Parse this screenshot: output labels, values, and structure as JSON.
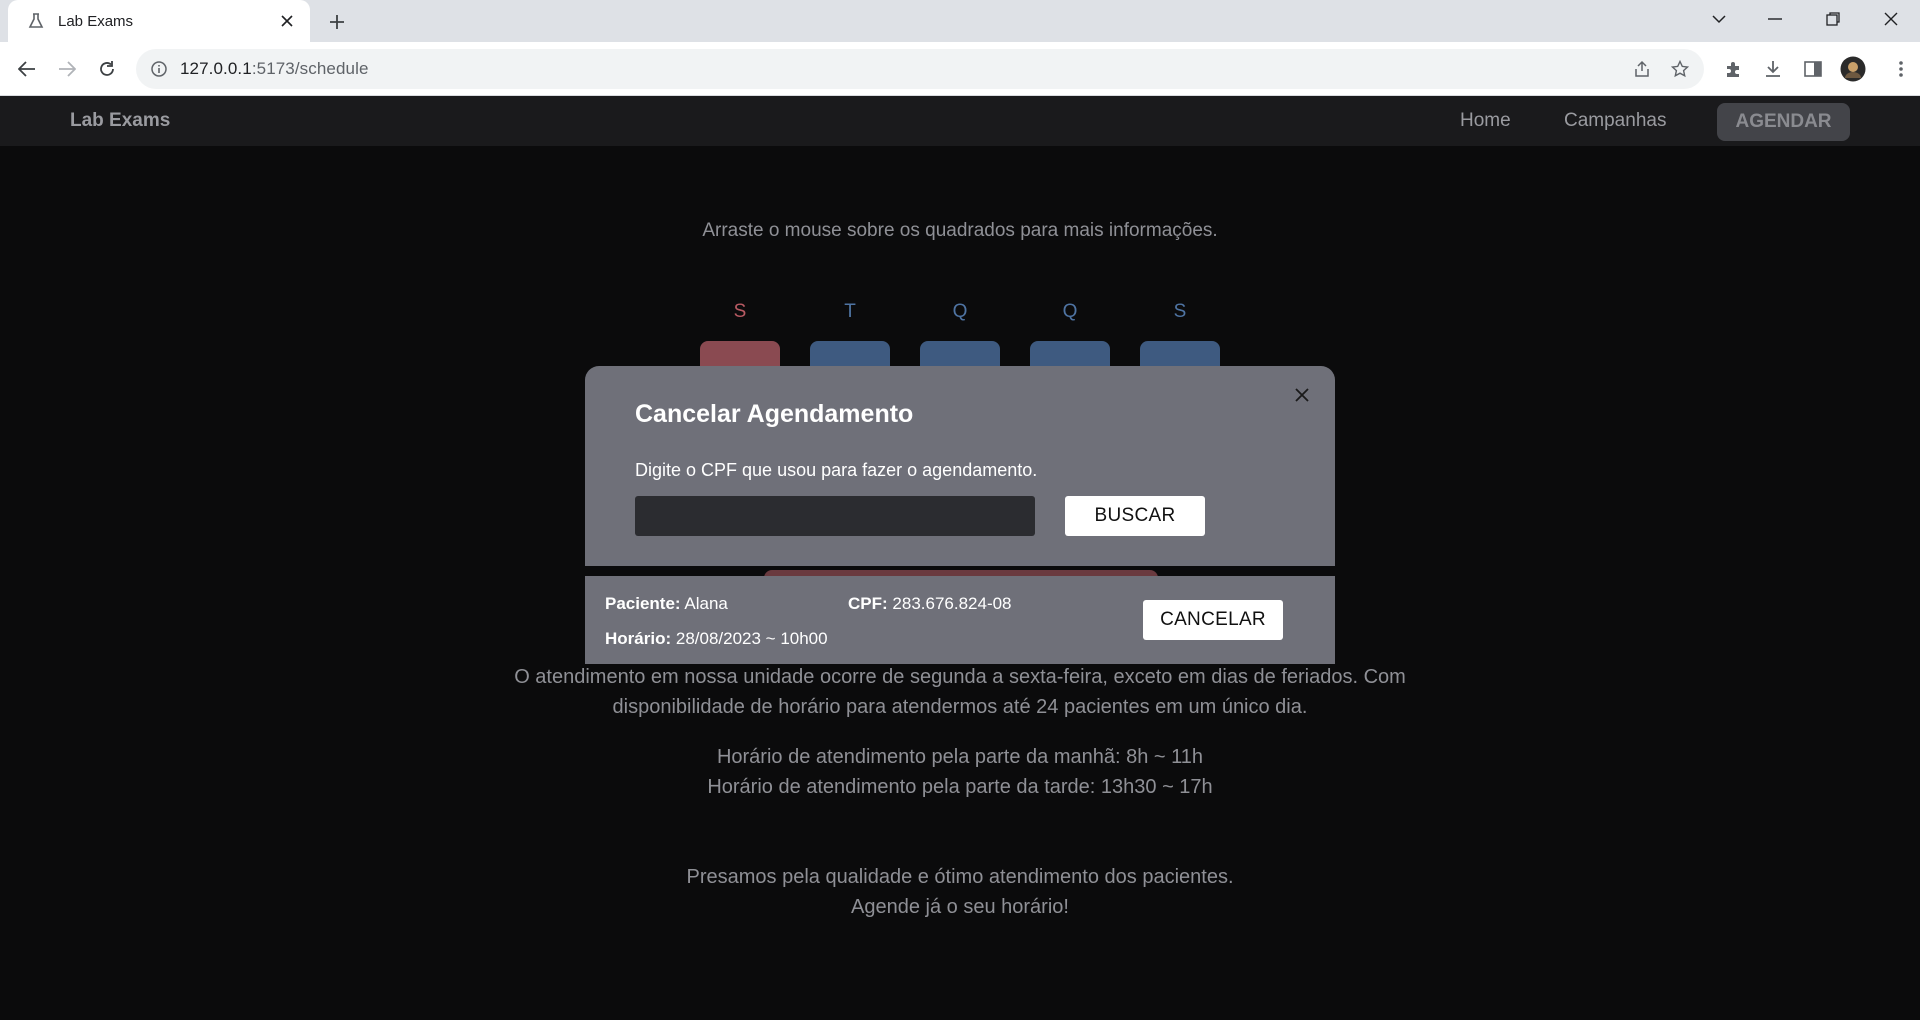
{
  "browser": {
    "tab_title": "Lab Exams",
    "url_host": "127.0.0.1",
    "url_path": ":5173/schedule"
  },
  "navbar": {
    "brand": "Lab Exams",
    "links": [
      "Home",
      "Campanhas"
    ],
    "cta": "AGENDAR"
  },
  "page": {
    "hint": "Arraste o mouse sobre os quadrados para mais informações.",
    "days": [
      {
        "letter": "S",
        "color": "#b85a63",
        "square": "#8a4a51"
      },
      {
        "letter": "T",
        "color": "#4f74a3",
        "square": "#3e5a80"
      },
      {
        "letter": "Q",
        "color": "#4f74a3",
        "square": "#3e5a80"
      },
      {
        "letter": "Q",
        "color": "#4f74a3",
        "square": "#3e5a80"
      },
      {
        "letter": "S",
        "color": "#4f74a3",
        "square": "#3e5a80"
      }
    ],
    "info_paragraph_line1": "O atendimento em nossa unidade ocorre de segunda a sexta-feira, exceto em dias de feriados. Com",
    "info_paragraph_line2": "disponibilidade de horário para atendermos até 24 pacientes em um único dia.",
    "hours_morning": "Horário de atendimento pela parte da manhã: 8h ~ 11h",
    "hours_afternoon": "Horário de atendimento pela parte da tarde: 13h30 ~ 17h",
    "closing_line1": "Presamos pela qualidade e ótimo atendimento dos pacientes.",
    "closing_line2": "Agende já o seu horário!"
  },
  "modal": {
    "title": "Cancelar Agendamento",
    "label": "Digite o CPF que usou para fazer o agendamento.",
    "input_value": "",
    "search_button": "BUSCAR",
    "result": {
      "patient_label": "Paciente:",
      "patient_value": "Alana",
      "cpf_label": "CPF:",
      "cpf_value": "283.676.824-08",
      "time_label": "Horário:",
      "time_value": "28/08/2023 ~ 10h00",
      "cancel_button": "CANCELAR"
    }
  },
  "colors": {
    "page_bg": "#0b0b0c",
    "navbar_bg": "#1a1a1c",
    "modal_bg": "#6f7079",
    "weekend_red": "#b85a63",
    "weekday_blue": "#4f74a3"
  }
}
